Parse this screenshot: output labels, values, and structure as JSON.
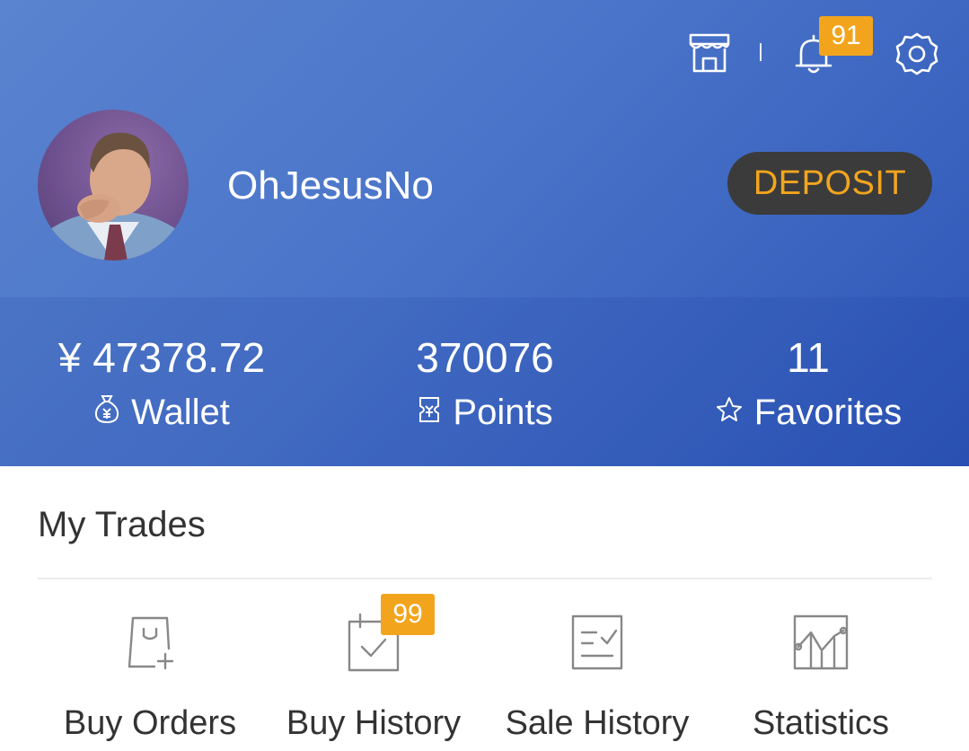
{
  "header": {
    "store_icon": "store-icon",
    "bell_icon": "bell-icon",
    "notification_count": "91",
    "settings_icon": "gear-icon"
  },
  "profile": {
    "avatar": "user-avatar-photo",
    "username": "OhJesusNo",
    "deposit_label": "DEPOSIT"
  },
  "stats": {
    "wallet": {
      "value": "¥ 47378.72",
      "label": "Wallet",
      "icon": "money-bag-icon"
    },
    "points": {
      "value": "370076",
      "label": "Points",
      "icon": "ticket-icon"
    },
    "favorites": {
      "value": "11",
      "label": "Favorites",
      "icon": "star-outline-icon"
    }
  },
  "trades": {
    "title": "My Trades",
    "items": [
      {
        "label": "Buy Orders",
        "icon": "shopping-bag-plus-icon"
      },
      {
        "label": "Buy History",
        "icon": "calendar-check-icon",
        "badge": "99"
      },
      {
        "label": "Sale History",
        "icon": "list-check-icon"
      },
      {
        "label": "Statistics",
        "icon": "line-chart-icon"
      }
    ]
  },
  "colors": {
    "header_gradient_start": "#5a84cf",
    "header_gradient_end": "#2d55b7",
    "accent_orange": "#f2a51c",
    "deposit_bg": "#3b3b3b",
    "text_dark": "#333333",
    "icon_gray": "#888888"
  }
}
